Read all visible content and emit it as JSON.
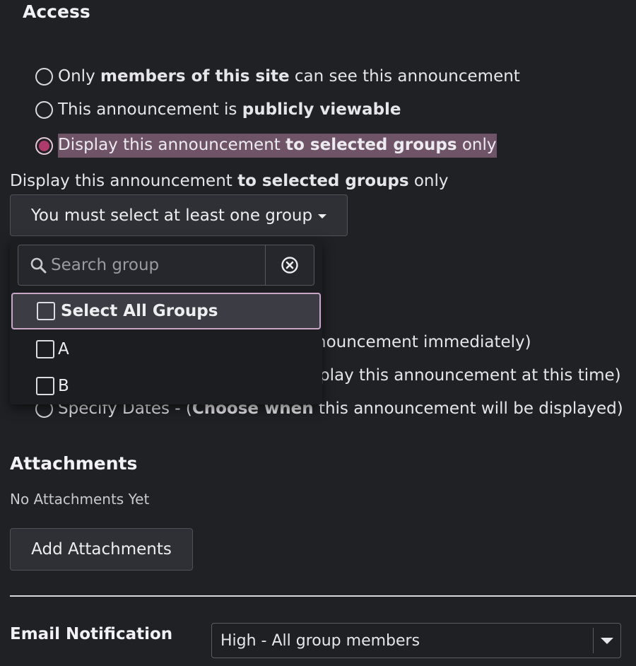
{
  "access": {
    "heading": "Access",
    "options": [
      {
        "pre": "Only ",
        "bold": "members of this site",
        "post": " can see this announcement",
        "checked": false
      },
      {
        "pre": "This announcement is ",
        "bold": "publicly viewable",
        "post": "",
        "checked": false
      },
      {
        "pre": "Display this announcement ",
        "bold": "to selected groups",
        "post": " only",
        "checked": true
      }
    ]
  },
  "groups": {
    "label_pre": "Display this announcement ",
    "label_bold": "to selected groups",
    "label_post": " only",
    "dropdown_button": "You must select at least one group",
    "search_placeholder": "Search group",
    "options": [
      {
        "label": "Select All Groups",
        "checked": false
      },
      {
        "label": "A",
        "checked": false
      },
      {
        "label": "B",
        "checked": false
      }
    ]
  },
  "availability": {
    "partial_1": "nouncement immediately)",
    "partial_2": "play this announcement at this time)",
    "specify_pre": "Specify Dates - (",
    "specify_bold": "Choose when",
    "specify_post": " this announcement will be displayed)"
  },
  "attachments": {
    "heading": "Attachments",
    "empty_text": "No Attachments Yet",
    "add_button": "Add Attachments"
  },
  "email": {
    "label": "Email Notification",
    "selected": "High - All group members"
  },
  "colors": {
    "background": "#202125",
    "highlight": "#6f5468",
    "radio_selected": "#b03a6c",
    "active_option_border": "#c9a6c6"
  },
  "icons": {
    "search": "search-icon",
    "clear": "close-circle-icon",
    "caret": "caret-down-icon"
  }
}
